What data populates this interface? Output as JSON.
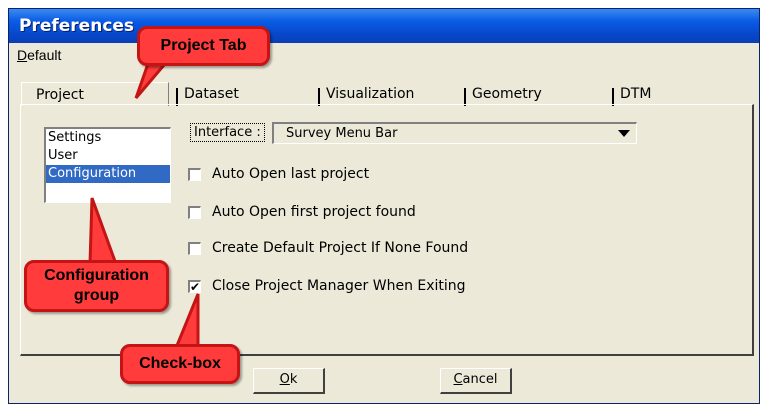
{
  "window": {
    "title": "Preferences"
  },
  "menu": {
    "default_first": "D",
    "default_rest": "efault"
  },
  "tabs": [
    {
      "label": "Project"
    },
    {
      "label": "Dataset"
    },
    {
      "label": "Visualization"
    },
    {
      "label": "Geometry"
    },
    {
      "label": "DTM"
    }
  ],
  "list": [
    "Settings",
    "User",
    "Configuration"
  ],
  "interface": {
    "label": "Interface :",
    "value": "Survey Menu Bar"
  },
  "checkboxes": [
    {
      "label": "Auto Open last project",
      "checked": false
    },
    {
      "label": "Auto Open first project found",
      "checked": false
    },
    {
      "label": "Create Default Project If None Found",
      "checked": false
    },
    {
      "label": "Close Project Manager When Exiting",
      "checked": true
    }
  ],
  "buttons": {
    "ok_first": "O",
    "ok_rest": "k",
    "cancel_first": "C",
    "cancel_rest": "ancel"
  },
  "callouts": {
    "project_tab": "Project Tab",
    "configuration_group": "Configuration group",
    "check_box": "Check-box"
  },
  "colors": {
    "callout_fill": "#ff3b3b",
    "title_blue": "#0a5ce6",
    "selection": "#316ac5"
  }
}
